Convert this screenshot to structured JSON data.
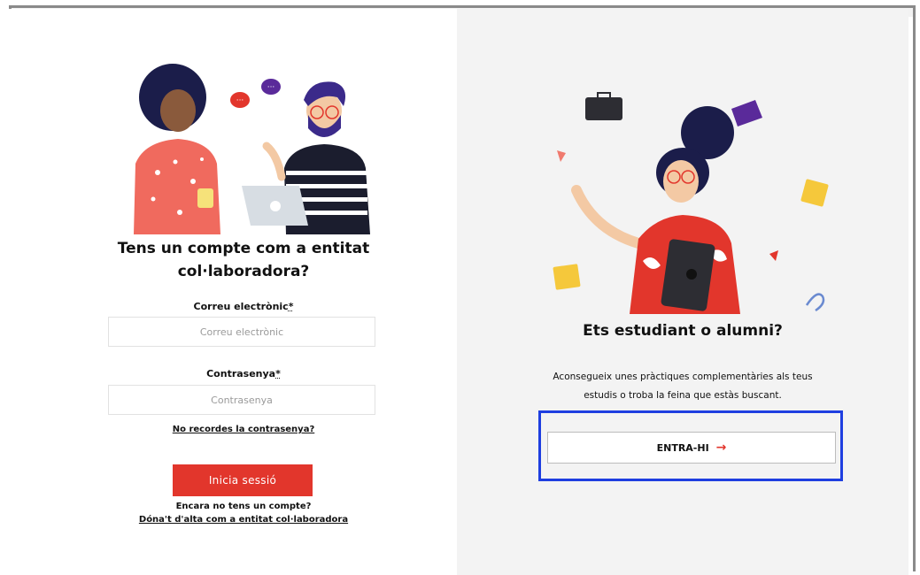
{
  "login": {
    "heading_line1": "Tens un compte com a entitat",
    "heading_line2": "col·laboradora?",
    "email_label": "Correu electrònic",
    "email_placeholder": "Correu electrònic",
    "password_label": "Contrasenya",
    "password_placeholder": "Contrasenya",
    "required_mark": "*",
    "forgot_link": "No recordes la contrasenya?",
    "submit_label": "Inicia sessió",
    "no_account_text": "Encara no tens un compte?",
    "register_link": "Dóna't d'alta com a entitat col·laboradora"
  },
  "student": {
    "heading": "Ets estudiant o alumni?",
    "description_line1": "Aconsegueix unes pràctiques complementàries als teus",
    "description_line2": "estudis o troba la feina que estàs buscant.",
    "enter_label": "ENTRA-HI",
    "enter_arrow": "→"
  },
  "colors": {
    "accent_red": "#e2362c",
    "highlight_blue": "#1e3ee0",
    "right_panel_bg": "#f3f3f3"
  }
}
